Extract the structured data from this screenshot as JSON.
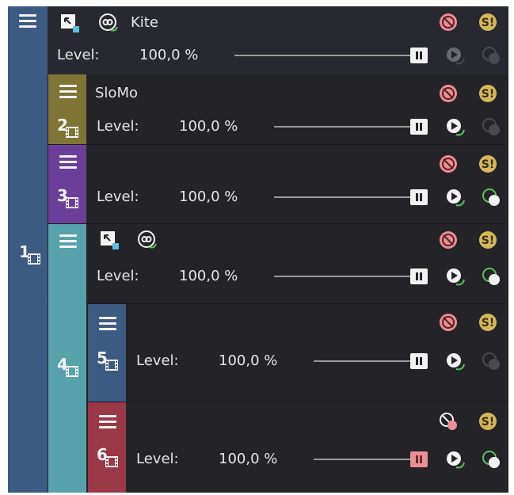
{
  "colors": {
    "panel_bg": "#232328",
    "track1": "#3b5b82",
    "track2": "#7e7535",
    "track3": "#6b3f98",
    "track4": "#58a2ab",
    "track5": "#3b5b82",
    "track6": "#9a3848",
    "mute_badge": "#e98f95",
    "solo_badge": "#d4b65c",
    "motion_green": "#5fbf5f"
  },
  "level_label": "Level:",
  "tracks": [
    {
      "number": "1",
      "name": "Kite",
      "level_value": "100,0 %",
      "icons": [
        "track-motion-icon",
        "compositing-mode-icon",
        "mute-icon",
        "solo-icon",
        "automation-icon",
        "bypass-motion-icon"
      ]
    },
    {
      "number": "2",
      "name": "SloMo",
      "level_value": "100,0 %",
      "icons": [
        "mute-icon",
        "solo-icon",
        "automation-icon",
        "bypass-motion-icon"
      ]
    },
    {
      "number": "3",
      "name": "",
      "level_value": "100,0 %",
      "icons": [
        "mute-icon",
        "solo-icon",
        "automation-icon",
        "bypass-motion-icon"
      ]
    },
    {
      "number": "4",
      "name": "",
      "level_value": "100,0 %",
      "icons": [
        "track-motion-icon",
        "compositing-mode-icon",
        "mute-icon",
        "solo-icon",
        "automation-icon",
        "bypass-motion-icon"
      ]
    },
    {
      "number": "5",
      "name": "",
      "level_value": "100,0 %",
      "icons": [
        "mute-icon",
        "solo-icon",
        "automation-icon",
        "bypass-motion-icon"
      ]
    },
    {
      "number": "6",
      "name": "",
      "level_value": "100,0 %",
      "icons": [
        "mute-icon",
        "solo-icon",
        "automation-icon",
        "bypass-motion-icon"
      ]
    }
  ]
}
